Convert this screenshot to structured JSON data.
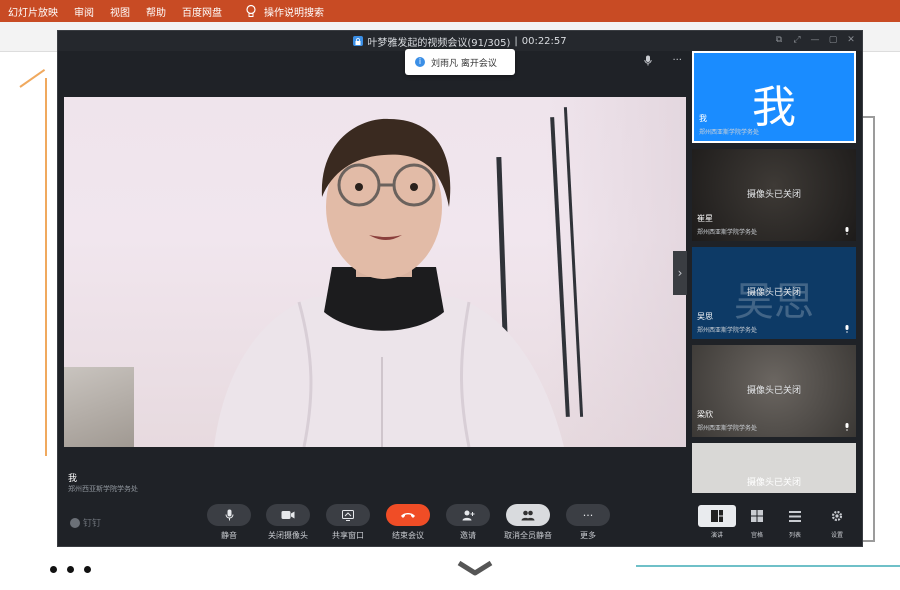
{
  "ribbon": {
    "items": [
      "幻灯片放映",
      "审阅",
      "视图",
      "帮助",
      "百度网盘"
    ],
    "search_label": "操作说明搜索",
    "bg_color": "#c84b24"
  },
  "window": {
    "title": "叶梦雅发起的视频会议(91/305)",
    "timer": "00:22:57",
    "controls": [
      "⧉",
      "⤢",
      "—",
      "▢",
      "✕"
    ]
  },
  "toast": {
    "text": "刘雨凡 离开会议"
  },
  "main": {
    "mic_icon": "mic-icon",
    "more": "···",
    "name": "我",
    "org": "郑州西亚斯学院学务处",
    "collapse": "›"
  },
  "participants": [
    {
      "big": "我",
      "name": "我",
      "org": "郑州西亚斯学院学务处",
      "camoff": ""
    },
    {
      "big": "",
      "name": "崔星",
      "org": "郑州西亚斯学院学务处",
      "camoff": "摄像头已关闭"
    },
    {
      "big": "吴思",
      "name": "吴思",
      "org": "郑州西亚斯学院学务处",
      "camoff": "摄像头已关闭"
    },
    {
      "big": "",
      "name": "梁欣",
      "org": "郑州西亚斯学院学务处",
      "camoff": "摄像头已关闭"
    },
    {
      "big": "",
      "name": "",
      "org": "",
      "camoff": "摄像头已关闭"
    }
  ],
  "toolbar": {
    "brand": "钉钉",
    "buttons": [
      {
        "label": "静音",
        "icon": "mic-icon"
      },
      {
        "label": "关闭摄像头",
        "icon": "camera-icon"
      },
      {
        "label": "共享窗口",
        "icon": "share-screen-icon"
      },
      {
        "label": "结束会议",
        "icon": "hangup-icon"
      },
      {
        "label": "邀请",
        "icon": "invite-icon"
      },
      {
        "label": "取消全员静音",
        "icon": "unmute-all-icon"
      },
      {
        "label": "更多",
        "icon": "more-icon"
      }
    ],
    "layouts": [
      {
        "label": "演讲",
        "icon": "speaker-layout-icon"
      },
      {
        "label": "宫格",
        "icon": "grid-layout-icon"
      },
      {
        "label": "列表",
        "icon": "list-layout-icon"
      },
      {
        "label": "设置",
        "icon": "settings-icon"
      }
    ],
    "hangup_color": "#f04d26"
  }
}
